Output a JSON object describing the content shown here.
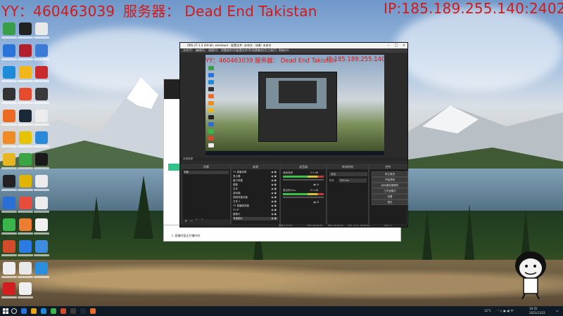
{
  "overlay": {
    "yy": "YY：460463039",
    "server": "服务器： Dead End Takistan",
    "ip": "IP:185.189.255.140:2402"
  },
  "obs": {
    "title": "OBS 27.1.3 (64-bit, windows) - 配置文件: 未命名 - 场景: 未命名",
    "menu": [
      "文件(F)",
      "编辑(E)",
      "视图(V)",
      "停靠部件(D)",
      "配置文件(P)",
      "场景集合(S)",
      "工具(T)",
      "帮助(H)"
    ],
    "preview_label": "未选择源",
    "docks": {
      "scenes": "场景",
      "sources": "来源",
      "mixer": "混音器",
      "transitions": "转场特效",
      "controls": "控件"
    },
    "scenes_items": [
      "场景"
    ],
    "sources_items": [
      "YY 直播录屏",
      "显示器",
      "窗口采集",
      "图像",
      "文本",
      "游戏源",
      "视频采集设备",
      "文本 2",
      "YY 直播服务器",
      "YY IP",
      "摄像头",
      "背景图片"
    ],
    "mixer": {
      "desktop_label": "桌面音频",
      "desktop_db": "0.0 dB",
      "mic_label": "麦克风/Aux",
      "mic_db": "0.0 dB"
    },
    "transitions": {
      "type": "淡出",
      "duration_label": "时长",
      "duration_value": "300 ms"
    },
    "controls": [
      "停止推流",
      "开始录制",
      "启动虚拟摄像机",
      "工作室模式",
      "设置",
      "退出"
    ],
    "status": {
      "dropped": "丢帧 0 (0.0%)",
      "live": "LIVE: 00:00:00",
      "rec": "REC: 00:00:00",
      "cpu": "CPU: 2.1%, 30.00 fps",
      "kbps": "kb/s: 0"
    }
  },
  "bg_app": {
    "bar_text": "人 直播间暂无开播时间"
  },
  "taskbar": {
    "temp": "12°C",
    "time": "19:55",
    "date": "2021/11/21"
  }
}
